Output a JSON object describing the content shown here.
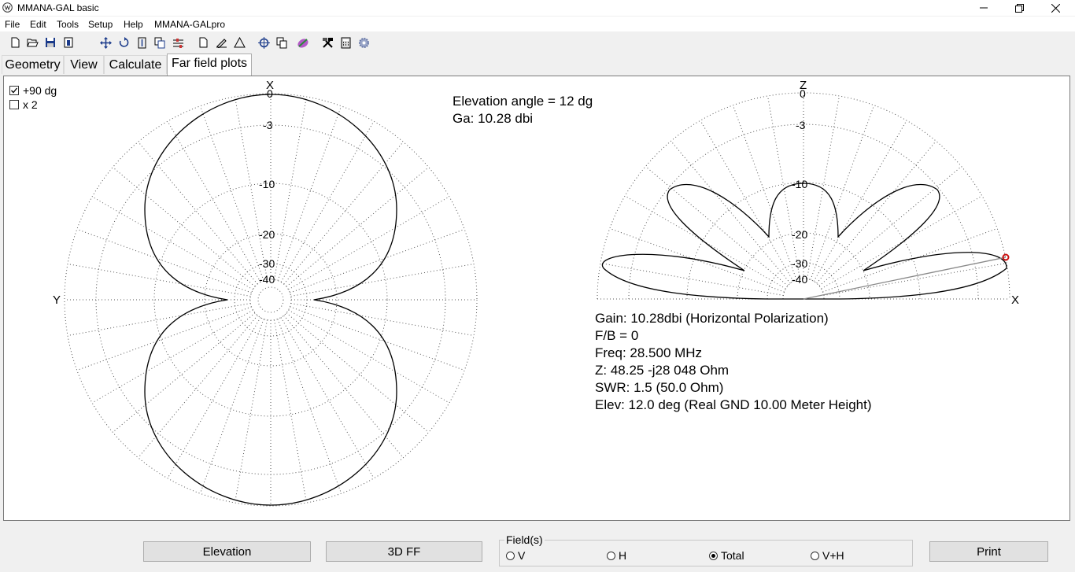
{
  "window": {
    "title": "MMANA-GAL basic",
    "minimize_icon": "minimize-icon",
    "maximize_icon": "restore-icon",
    "close_icon": "close-icon"
  },
  "menu": [
    "File",
    "Edit",
    "Tools",
    "Setup",
    "Help",
    "MMANA-GALpro"
  ],
  "toolbar_icons": [
    "new-file-icon",
    "open-folder-icon",
    "save-icon",
    "info-icon",
    "move-icon",
    "rotate-icon",
    "stretch-icon",
    "copy-icon",
    "align-icon",
    "page-icon",
    "edit-icon",
    "triangle-icon",
    "target-icon",
    "duplicate-icon",
    "palette-icon",
    "tools-icon",
    "calculator-icon",
    "gear-icon"
  ],
  "tabs": [
    {
      "label": "Geometry",
      "active": false
    },
    {
      "label": "View",
      "active": false
    },
    {
      "label": "Calculate",
      "active": false
    },
    {
      "label": "Far field plots",
      "active": true
    }
  ],
  "options": {
    "plus90": {
      "label": "+90 dg",
      "checked": true
    },
    "x2": {
      "label": "x 2",
      "checked": false
    }
  },
  "azimuth_plot": {
    "axis_top": "X",
    "axis_left": "Y",
    "ring_labels": [
      "0",
      "-3",
      "-10",
      "-20",
      "-30",
      "-40"
    ]
  },
  "elevation_plot": {
    "axis_top": "Z",
    "axis_right": "X",
    "ring_labels": [
      "0",
      "-3",
      "-10",
      "-20",
      "-30",
      "-40"
    ]
  },
  "elevation_info": {
    "angle": "Elevation angle = 12 dg",
    "gain": "Ga: 10.28 dbi"
  },
  "results": {
    "gain": "Gain: 10.28dbi (Horizontal Polarization)",
    "fb": "F/B = 0",
    "freq": "Freq:  28.500 MHz",
    "z": "Z: 48.25 -j28 048 Ohm",
    "swr": "SWR: 1.5 (50.0 Ohm)",
    "elev": "Elev: 12.0 deg (Real GND 10.00 Meter Height)"
  },
  "buttons": {
    "elevation": "Elevation",
    "ff3d": "3D FF",
    "print": "Print"
  },
  "fields": {
    "legend": "Field(s)",
    "options": [
      {
        "label": "V",
        "selected": false
      },
      {
        "label": "H",
        "selected": false
      },
      {
        "label": "Total",
        "selected": true
      },
      {
        "label": "V+H",
        "selected": false
      }
    ]
  },
  "colors": {
    "marker": "#cc1111",
    "grid": "#555555",
    "pattern": "#000000"
  }
}
